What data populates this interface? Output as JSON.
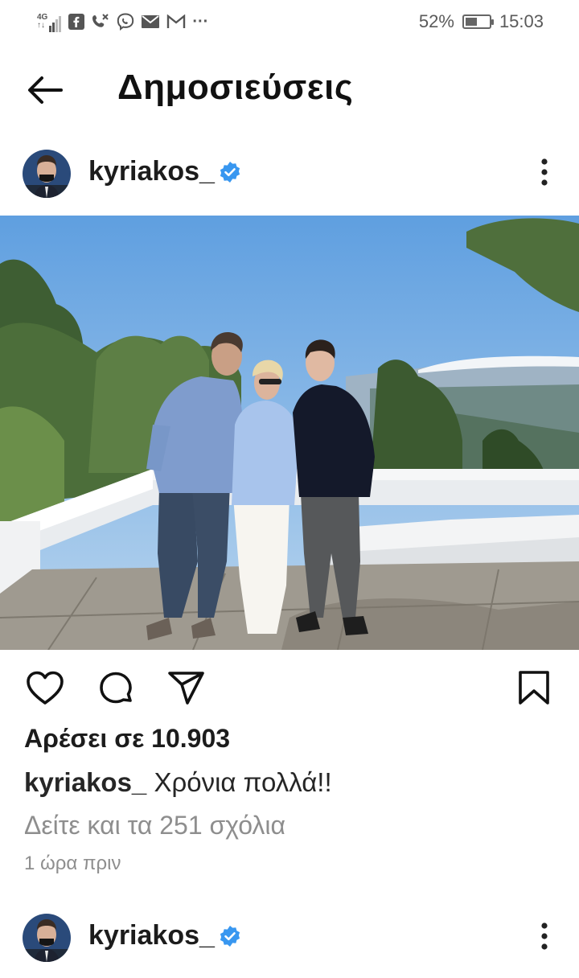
{
  "status_bar": {
    "network": "4G",
    "battery_percent": "52%",
    "battery_level": 0.52,
    "time": "15:03",
    "more": "···",
    "icons": [
      "signal-icon",
      "facebook-icon",
      "missed-call-icon",
      "viber-icon",
      "mail-icon",
      "gmail-icon"
    ]
  },
  "header": {
    "title": "Δημοσιεύσεις",
    "back_icon": "arrow-left-icon"
  },
  "post": {
    "username": "kyriakos_",
    "verified": true,
    "likes_text": "Αρέσει σε 10.903",
    "caption_user": "kyriakos_",
    "caption_text": "Χρόνια πολλά!!",
    "comments_link": "Δείτε και τα 251 σχόλια",
    "timestamp": "1 ώρα πριν",
    "action_icons": [
      "heart-icon",
      "comment-icon",
      "share-icon",
      "bookmark-icon"
    ]
  },
  "next_post": {
    "username": "kyriakos_",
    "verified": true
  },
  "colors": {
    "verified_blue": "#3897f0",
    "text_primary": "#262626",
    "text_secondary": "#8e8e8e",
    "sky": "#7fb6ea"
  }
}
